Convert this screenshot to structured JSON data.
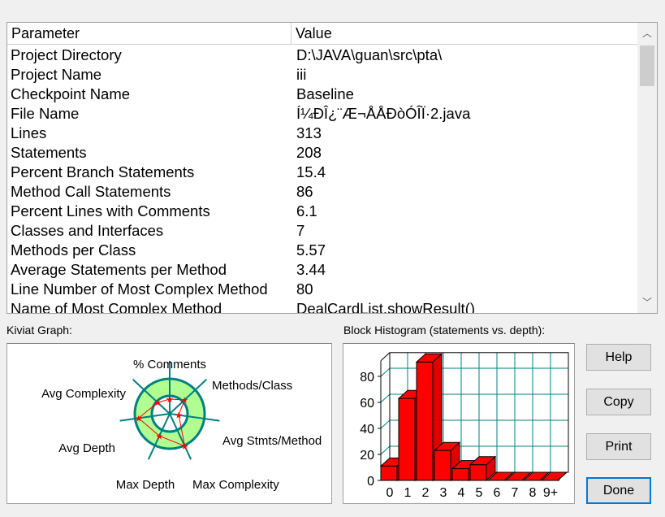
{
  "table": {
    "headers": [
      "Parameter",
      "Value"
    ],
    "rows": [
      [
        "Project Directory",
        "D:\\JAVA\\guan\\src\\pta\\"
      ],
      [
        "Project Name",
        "iii"
      ],
      [
        "Checkpoint Name",
        "Baseline"
      ],
      [
        "File Name",
        "Í¼ÐÎ¿¨Æ¬ÅÅÐòÓÎÏ·2.java"
      ],
      [
        "Lines",
        "313"
      ],
      [
        "Statements",
        "208"
      ],
      [
        "Percent Branch Statements",
        "15.4"
      ],
      [
        "Method Call Statements",
        "86"
      ],
      [
        "Percent Lines with Comments",
        "6.1"
      ],
      [
        "Classes and Interfaces",
        "7"
      ],
      [
        "Methods per Class",
        "5.57"
      ],
      [
        "Average Statements per Method",
        "3.44"
      ],
      [
        "Line Number of Most Complex Method",
        "80"
      ],
      [
        "Name of Most Complex Method",
        "DealCardList.showResult()"
      ]
    ]
  },
  "kiviat": {
    "label": "Kiviat Graph:",
    "axes": [
      "% Comments",
      "Methods/Class",
      "Avg Stmts/Method",
      "Max Complexity",
      "Max Depth",
      "Avg Depth",
      "Avg Complexity"
    ],
    "values": [
      0.42,
      0.58,
      0.26,
      1.02,
      0.7,
      0.9,
      0.47
    ],
    "ring_color": "#b0ff90",
    "line_color": "#008080",
    "plot_color": "#ff0000"
  },
  "histogram": {
    "label": "Block Histogram (statements vs. depth):"
  },
  "chart_data": {
    "type": "bar",
    "title": "Block Histogram (statements vs. depth):",
    "categories": [
      "0",
      "1",
      "2",
      "3",
      "4",
      "5",
      "6",
      "7",
      "8",
      "9+"
    ],
    "values": [
      11,
      63,
      91,
      23,
      9,
      12,
      0,
      0,
      0,
      0
    ],
    "ylim": [
      0,
      90
    ],
    "yticks": [
      0,
      20,
      40,
      60,
      80
    ],
    "bar_color": "#ff0000",
    "grid_color": "#008080"
  },
  "buttons": {
    "help": "Help",
    "copy": "Copy",
    "print": "Print",
    "done": "Done"
  }
}
